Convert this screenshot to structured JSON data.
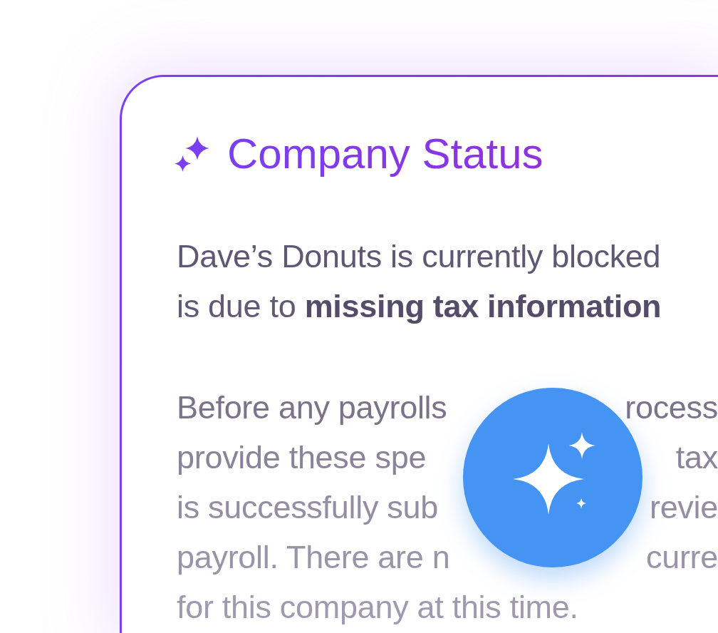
{
  "card": {
    "title": "Company Status",
    "paragraphs": [
      {
        "lines": [
          {
            "start": "Dave’s Donuts is currently blocked"
          },
          {
            "start": "is due to **missing tax information**"
          }
        ]
      },
      {
        "lines": [
          {
            "start": "Before any payrolls",
            "end": "rocess"
          },
          {
            "start": "provide these spe",
            "end": "tax"
          },
          {
            "start": "is successfully sub",
            "end": "revie"
          },
          {
            "start": "payroll. There are n",
            "end": "curre"
          },
          {
            "start": "for this company at this time."
          }
        ]
      }
    ]
  }
}
